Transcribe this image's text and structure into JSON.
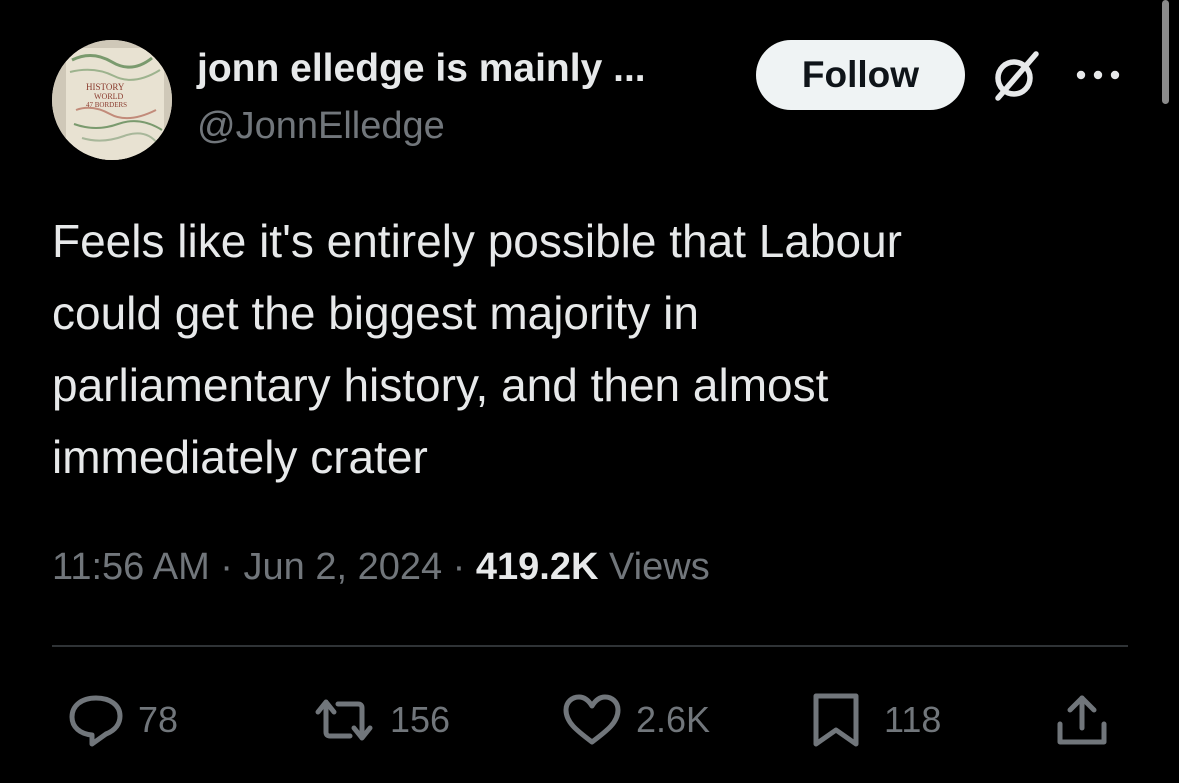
{
  "author": {
    "display_name": "jonn elledge is mainly ...",
    "handle": "@JonnElledge",
    "avatar_icon": "book-cover-avatar",
    "avatar_book_lines": [
      "HISTORY",
      "WORLD",
      "47 BORDERS"
    ]
  },
  "header": {
    "follow_label": "Follow",
    "grok_icon": "grok-icon",
    "more_icon": "more-icon"
  },
  "tweet": {
    "text_lines": [
      "Feels like it's entirely possible that Labour",
      "could get the biggest majority in",
      "parliamentary history, and then almost",
      "immediately crater"
    ]
  },
  "meta": {
    "time": "11:56 AM",
    "separator": " · ",
    "date": "Jun 2, 2024",
    "views_count": "419.2K",
    "views_label": "Views"
  },
  "actions": {
    "replies": "78",
    "retweets": "156",
    "likes": "2.6K",
    "bookmarks": "118"
  },
  "colors": {
    "background": "#000000",
    "text_primary": "#e7e9ea",
    "text_secondary": "#71767b",
    "divider": "#2f3336",
    "follow_bg": "#eff3f4"
  }
}
